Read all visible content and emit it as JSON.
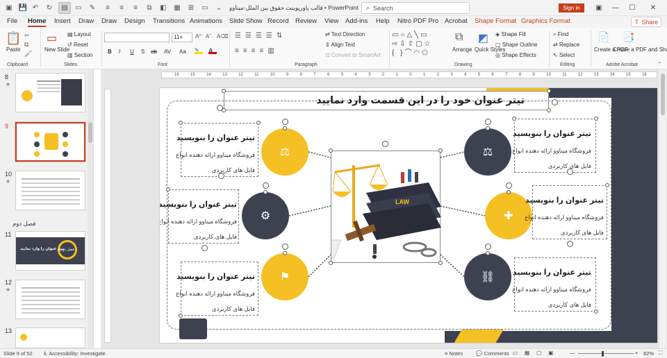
{
  "titlebar": {
    "title": "قالب پاورپوینت حقوق بین الملل-میناوو  •  PowerPoint",
    "search_placeholder": "Search",
    "sign_in": "Sign in"
  },
  "menu": {
    "tabs": [
      "File",
      "Home",
      "Insert",
      "Draw",
      "Draw",
      "Design",
      "Transitions",
      "Animations",
      "Slide Show",
      "Record",
      "Review",
      "View",
      "Add-ins",
      "Help",
      "Nitro PDF Pro",
      "Acrobat"
    ],
    "context_tabs": [
      "Shape Format",
      "Graphics Format"
    ],
    "share": "Share"
  },
  "ribbon": {
    "clipboard": {
      "paste": "Paste",
      "label": "Clipboard"
    },
    "slides": {
      "new_slide": "New Slide",
      "layout": "Layout",
      "reset": "Reset",
      "section": "Section",
      "label": "Slides"
    },
    "font": {
      "size": "11+",
      "label": "Font",
      "buttons": [
        "B",
        "I",
        "U",
        "S",
        "ab",
        "AV",
        "Aa"
      ]
    },
    "paragraph": {
      "text_direction": "Text Direction",
      "align_text": "Align Text",
      "convert": "Convert to SmartArt",
      "label": "Paragraph"
    },
    "drawing": {
      "arrange": "Arrange",
      "quick_styles": "Quick Styles",
      "shape_fill": "Shape Fill",
      "shape_outline": "Shape Outline",
      "shape_effects": "Shape Effects",
      "label": "Drawing"
    },
    "editing": {
      "find": "Find",
      "replace": "Replace",
      "select": "Select",
      "label": "Editing"
    },
    "acrobat": {
      "create_pdf": "Create a PDF",
      "create_share": "Create a PDF and Share link",
      "label": "Adobe Acrobat"
    }
  },
  "ruler": {
    "h_ticks": [
      "16",
      "15",
      "14",
      "13",
      "12",
      "11",
      "10",
      "9",
      "8",
      "7",
      "6",
      "5",
      "4",
      "3",
      "2",
      "1",
      "0",
      "1",
      "2",
      "3",
      "4",
      "5",
      "6",
      "7",
      "8",
      "9",
      "10",
      "11",
      "12",
      "13",
      "14",
      "15",
      "16"
    ]
  },
  "thumbnails": [
    {
      "num": "8",
      "star": "★",
      "selected": false
    },
    {
      "num": "9",
      "star": "",
      "selected": true
    },
    {
      "num": "10",
      "star": "★",
      "selected": false
    },
    {
      "num": "11",
      "star": "",
      "selected": false,
      "section": "فصل دوم"
    },
    {
      "num": "12",
      "star": "★",
      "selected": false
    },
    {
      "num": "13",
      "star": "",
      "selected": false
    }
  ],
  "slide": {
    "title": "تیتر عنوان خود را در این قسمت وارد نمایید",
    "items_right": [
      {
        "title": "تیتر عنوان را بنویسید",
        "line1": "فروشگاه میناوو ارائه دهنده انواع",
        "line2": "فایل های کاربردی"
      },
      {
        "title": "تیتر عنوان را بنویسید",
        "line1": "فروشگاه میناوو ارائه دهنده انواع",
        "line2": "فایل های کاربردی"
      },
      {
        "title": "تیتر عنوان را بنویسید",
        "line1": "فروشگاه میناوو ارائه دهنده انواع",
        "line2": "فایل های کاربردی"
      }
    ],
    "items_left": [
      {
        "title": "تیتر عنوان را بنویسید",
        "line1": "فروشگاه میناوو ارائه دهنده انواع",
        "line2": "فایل های کاربردی"
      },
      {
        "title": "تیتر عنوان را بنویسید",
        "line1": "فروشگاه میناوو ارائه دهنده انواع",
        "line2": "فایل های کاربردی"
      },
      {
        "title": "تیتر عنوان را بنویسید",
        "line1": "فروشگاه میناوو ارائه دهنده انواع",
        "line2": "فایل های کاربردی"
      }
    ],
    "law_label": "LAW",
    "thumb11_text": "تیتر عنوان را وارد نمایید",
    "thumb11_badge": "فصل دوم"
  },
  "status": {
    "slide": "Slide 9 of 52",
    "accessibility": "Accessibility: Investigate",
    "notes": "Notes",
    "comments": "Comments",
    "zoom": "82%"
  },
  "colors": {
    "accent": "#c43e1c",
    "yellow": "#f5c023",
    "dark": "#3e4250"
  }
}
